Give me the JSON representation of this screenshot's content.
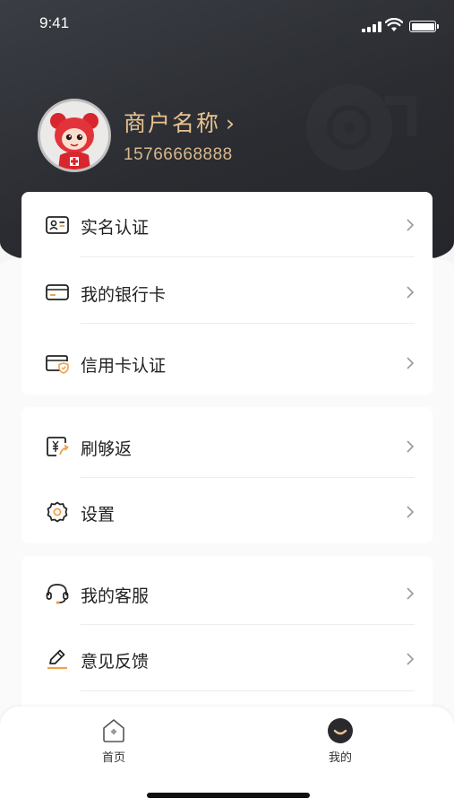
{
  "status_bar": {
    "time": "9:41"
  },
  "profile": {
    "merchant_name": "商户名称",
    "arrow": "›",
    "phone": "15766668888"
  },
  "menu_groups": [
    {
      "items": [
        {
          "label": "实名认证",
          "icon": "id-card-icon"
        },
        {
          "label": "我的银行卡",
          "icon": "bank-card-icon"
        },
        {
          "label": "信用卡认证",
          "icon": "credit-card-shield-icon"
        }
      ]
    },
    {
      "items": [
        {
          "label": "刷够返",
          "icon": "yuan-cashback-icon"
        },
        {
          "label": "设置",
          "icon": "gear-icon"
        }
      ]
    },
    {
      "items": [
        {
          "label": "我的客服",
          "icon": "headset-icon"
        },
        {
          "label": "意见反馈",
          "icon": "pen-feedback-icon"
        }
      ]
    }
  ],
  "tabbar": {
    "tabs": [
      {
        "label": "首页",
        "icon": "home-icon",
        "active": false
      },
      {
        "label": "我的",
        "icon": "profile-face-icon",
        "active": true
      }
    ]
  },
  "colors": {
    "header_dark": "#2a2c31",
    "gold_accent": "#e9c28f",
    "icon_orange": "#f0a24a",
    "background": "#f5f5f6"
  }
}
